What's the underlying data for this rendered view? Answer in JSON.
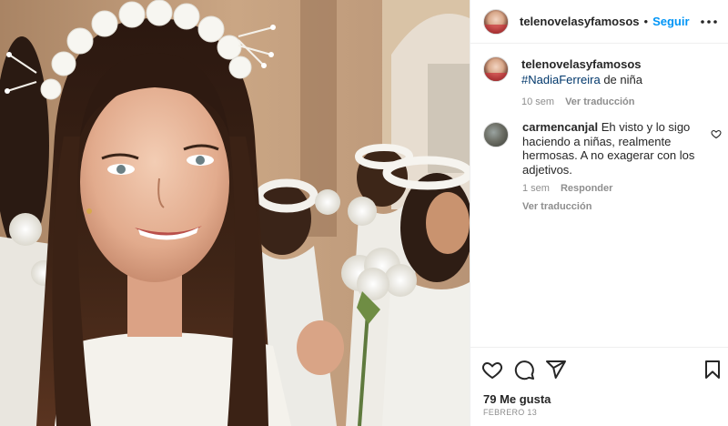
{
  "post": {
    "image_alt": "Foto de una niña sonriente con corona de flores blancas en su primera comunión",
    "author": {
      "username": "telenovelasyfamosos",
      "separator": "•",
      "follow_label": "Seguir"
    },
    "caption": {
      "username": "telenovelasyfamosos",
      "hashtag": "#NadiaFerreira",
      "text_after": " de niña",
      "time": "10 sem",
      "translate_label": "Ver traducción"
    },
    "comments": [
      {
        "username": "carmencanjal",
        "text": "Eh visto y lo sigo haciendo a niñas, realmente hermosas. A no exagerar con los adjetivos.",
        "time": "1 sem",
        "reply_label": "Responder",
        "translate_label": "Ver traducción"
      }
    ],
    "likes": "79 Me gusta",
    "date": "FEBRERO 13"
  },
  "icons": {
    "more": "more-horizontal-icon",
    "like": "heart-icon",
    "comment": "comment-bubble-icon",
    "share": "paper-plane-icon",
    "save": "bookmark-icon"
  },
  "colors": {
    "link": "#0095f6",
    "hashtag": "#00376b",
    "text": "#262626",
    "muted": "#8e8e8e",
    "border": "#efefef"
  }
}
